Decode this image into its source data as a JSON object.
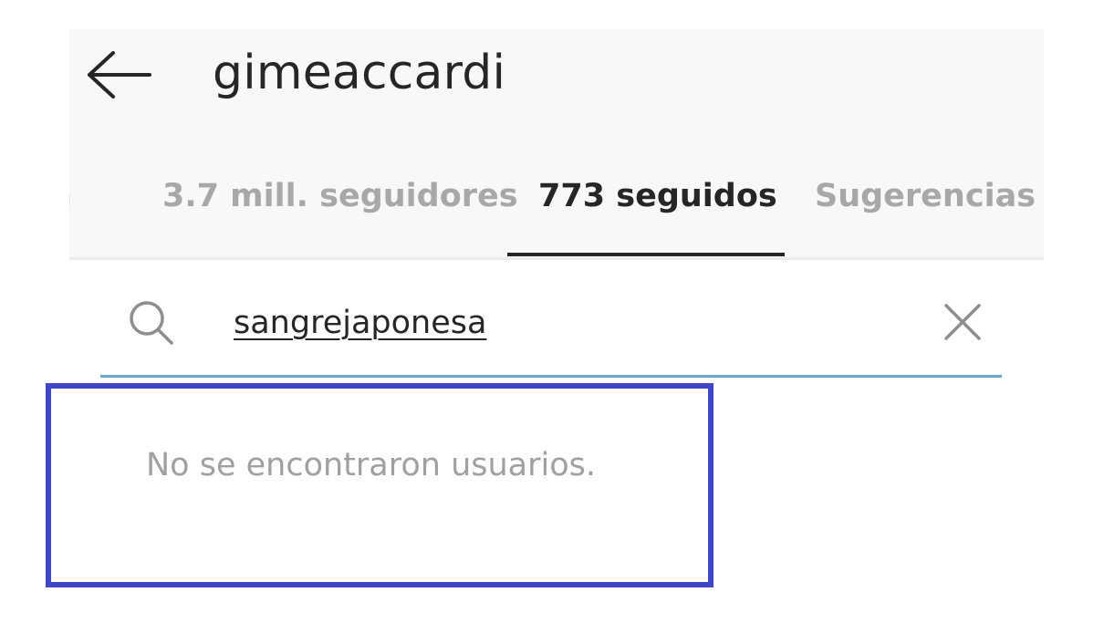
{
  "header": {
    "back_icon": "arrow-left-icon",
    "username": "gimeaccardi"
  },
  "tabs": [
    {
      "label": "ín",
      "active": false
    },
    {
      "label": "3.7 mill. seguidores",
      "active": false
    },
    {
      "label": "773 seguidos",
      "active": true
    },
    {
      "label": "Sugerencias",
      "active": false
    }
  ],
  "search": {
    "icon": "search-icon",
    "value": "sangrejaponesa",
    "clear_icon": "close-icon"
  },
  "results": {
    "empty_message": "No se encontraron usuarios."
  },
  "colors": {
    "highlight_border": "#4147c4",
    "search_underline": "#6aa9c9",
    "active_text": "#262626",
    "inactive_text": "#a8a8a8"
  }
}
